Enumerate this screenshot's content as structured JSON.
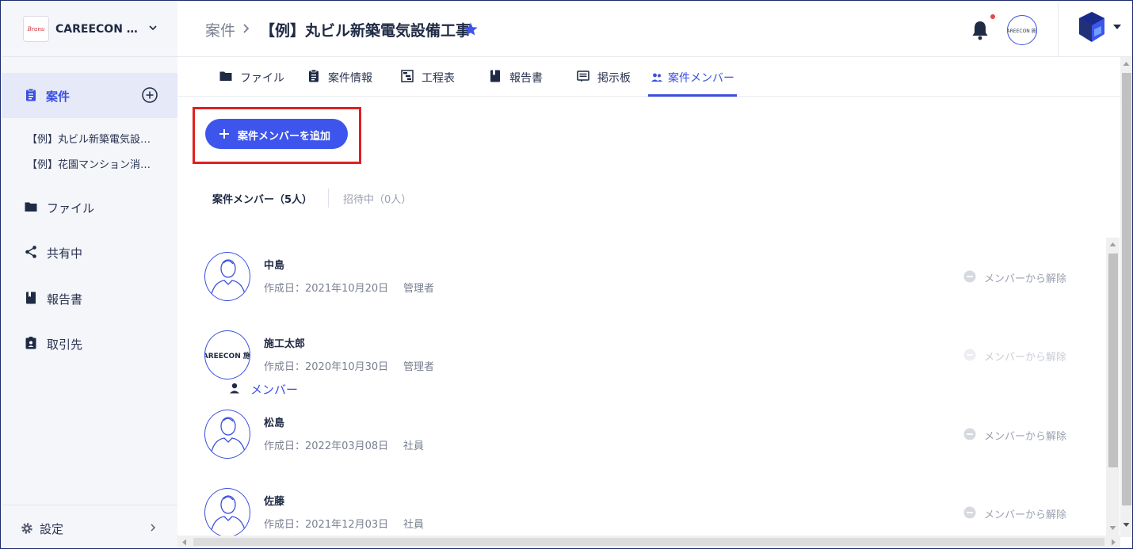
{
  "sidebar": {
    "org_logo_text": "Branu",
    "org_name": "CAREECON 施工",
    "nav_active_label": "案件",
    "projects": [
      {
        "label": "【例】丸ビル新築電気設備工事"
      },
      {
        "label": "【例】花園マンション消防設備工事"
      }
    ],
    "items": [
      {
        "label": "ファイル",
        "icon": "folder-icon"
      },
      {
        "label": "共有中",
        "icon": "share-icon"
      },
      {
        "label": "報告書",
        "icon": "book-icon"
      },
      {
        "label": "取引先",
        "icon": "contact-badge-icon"
      },
      {
        "label": "メンバー",
        "icon": "person-icon"
      }
    ],
    "settings_label": "設定"
  },
  "header": {
    "breadcrumb_root": "案件",
    "breadcrumb_current": "【例】丸ビル新築電気設備工事",
    "avatar_text": "CAREECON 施工"
  },
  "tabs": [
    {
      "label": "ファイル",
      "icon": "folder-icon"
    },
    {
      "label": "案件情報",
      "icon": "clipboard-icon"
    },
    {
      "label": "工程表",
      "icon": "gantt-icon"
    },
    {
      "label": "報告書",
      "icon": "book-icon"
    },
    {
      "label": "掲示板",
      "icon": "message-board-icon"
    },
    {
      "label": "案件メンバー",
      "icon": "people-icon",
      "active": true
    }
  ],
  "main": {
    "add_member_label": "案件メンバーを追加",
    "subtab_members": "案件メンバー（5人）",
    "subtab_invited": "招待中（0人）",
    "remove_label": "メンバーから解除",
    "members": [
      {
        "name": "中島",
        "created": "作成日：2021年10月20日",
        "role": "管理者",
        "avatar": "person",
        "remove_enabled": true
      },
      {
        "name": "施工太郎",
        "created": "作成日：2020年10月30日",
        "role": "管理者",
        "avatar": "CAREECON 施工",
        "remove_enabled": false
      },
      {
        "name": "松島",
        "created": "作成日：2022年03月08日",
        "role": "社員",
        "avatar": "person",
        "remove_enabled": true
      },
      {
        "name": "佐藤",
        "created": "作成日：2021年12月03日",
        "role": "社員",
        "avatar": "person",
        "remove_enabled": true
      }
    ]
  },
  "colors": {
    "accent": "#3d55ec",
    "highlight_box": "#e02020",
    "sidebar_bg": "#f4f6fa",
    "notification_dot": "#e34a4a"
  }
}
